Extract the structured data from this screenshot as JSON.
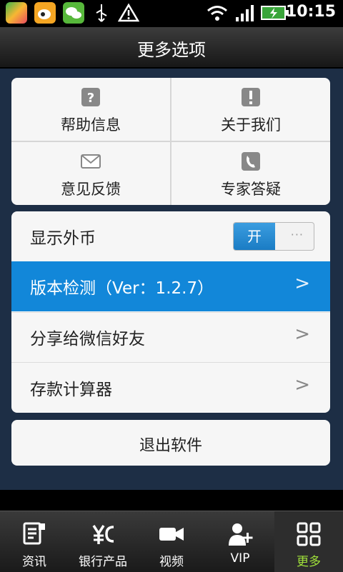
{
  "status_bar": {
    "time": "10:15",
    "icons": [
      "app-icon",
      "weibo-icon",
      "wechat-icon",
      "usb-icon",
      "warning-icon",
      "wifi-icon",
      "signal-icon",
      "battery-icon"
    ]
  },
  "header": {
    "title": "更多选项"
  },
  "grid": {
    "items": [
      {
        "label": "帮助信息",
        "icon": "help-icon"
      },
      {
        "label": "关于我们",
        "icon": "about-icon"
      },
      {
        "label": "意见反馈",
        "icon": "mail-icon"
      },
      {
        "label": "专家答疑",
        "icon": "phone-icon"
      }
    ]
  },
  "settings": {
    "show_currency": {
      "label": "显示外币",
      "toggle_on": "开",
      "toggle_dots": "···"
    },
    "rows": [
      {
        "label": "版本检测（Ver：1.2.7）",
        "arrow": ">"
      },
      {
        "label": "分享给微信好友",
        "arrow": ">"
      },
      {
        "label": "存款计算器",
        "arrow": ">"
      }
    ]
  },
  "exit": {
    "label": "退出软件"
  },
  "tabs": [
    {
      "label": "资讯",
      "icon": "news-icon"
    },
    {
      "label": "银行产品",
      "icon": "yen-icon"
    },
    {
      "label": "视频",
      "icon": "video-icon"
    },
    {
      "label": "VIP",
      "icon": "vip-icon"
    },
    {
      "label": "更多",
      "icon": "grid-icon"
    }
  ],
  "colors": {
    "accent": "#1287d9",
    "active_tab": "#9fe03a",
    "background": "#1d2e45"
  }
}
